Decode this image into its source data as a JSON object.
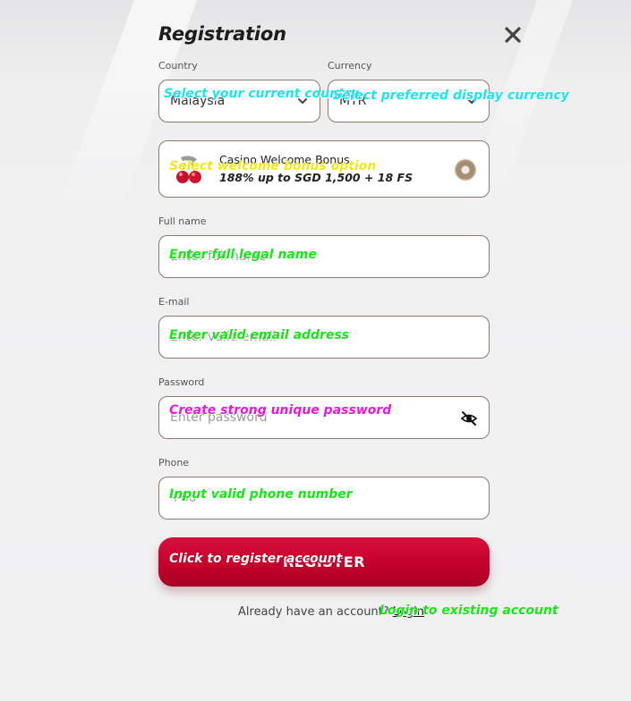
{
  "form": {
    "title": "Registration",
    "close_label": "Close",
    "country": {
      "label": "Country",
      "value": "Malaysia"
    },
    "currency": {
      "label": "Currency",
      "value": "MYR"
    },
    "bonus": {
      "title": "Casino Welcome Bonus",
      "subtitle": "188% up to SGD 1,500 + 18 FS"
    },
    "full_name": {
      "label": "Full name",
      "placeholder": "Enter full name"
    },
    "email": {
      "label": "E-mail",
      "placeholder": "Enter valid email"
    },
    "password": {
      "label": "Password",
      "placeholder": "Enter password"
    },
    "phone": {
      "label": "Phone",
      "placeholder": "+60"
    },
    "register_label": "REGISTER",
    "login_prompt": "Already have an account?",
    "login_link": "Login"
  },
  "annotations": {
    "country": "Select your current country",
    "currency": "Select preferred display currency",
    "bonus": "Select welcome bonus option",
    "full_name": "Enter full legal name",
    "email": "Enter valid email address",
    "password": "Create strong unique password",
    "phone": "Input valid phone number",
    "register": "Click to register account",
    "login": "Login to existing account"
  },
  "colors": {
    "accent": "#c4002c",
    "annotation_cyan": "#1ce4f0",
    "annotation_yellow": "#f2e81a",
    "annotation_green": "#19e619",
    "annotation_magenta": "#e619d6"
  },
  "icons": {
    "close": "close-icon",
    "chevron": "chevron-down-icon",
    "bonus": "cherries-icon",
    "eye": "eye-off-icon"
  }
}
